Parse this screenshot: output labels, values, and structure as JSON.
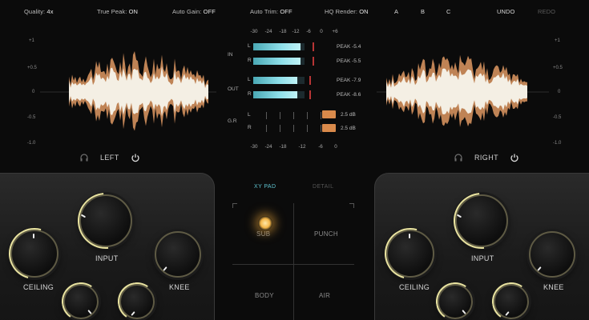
{
  "top_bar": {
    "quality_label": "Quality:",
    "quality_value": "4x",
    "true_peak_label": "True Peak:",
    "true_peak_value": "ON",
    "auto_gain_label": "Auto Gain:",
    "auto_gain_value": "OFF",
    "auto_trim_label": "Auto Trim:",
    "auto_trim_value": "OFF",
    "hq_render_label": "HQ Render:",
    "hq_render_value": "ON",
    "presets": [
      "A",
      "B",
      "C"
    ],
    "undo_label": "UNDO",
    "redo_label": "REDO"
  },
  "waveform_scale": [
    "+1",
    "+0.5",
    "0",
    "-0.5",
    "-1.0"
  ],
  "left_channel": {
    "label": "LEFT"
  },
  "right_channel": {
    "label": "RIGHT"
  },
  "meters": {
    "scale_top": [
      "-30",
      "-24",
      "-18",
      "-12",
      "-6",
      "0",
      "+6"
    ],
    "scale_bottom": [
      "-30",
      "-24",
      "-18",
      "-12",
      "-6",
      "0"
    ],
    "in_label": "IN",
    "out_label": "OUT",
    "gr_label": "G.R",
    "ch_l": "L",
    "ch_r": "R",
    "in_l": {
      "peak": "PEAK -5.4",
      "level": 0.92
    },
    "in_r": {
      "peak": "PEAK -5.5",
      "level": 0.92
    },
    "out_l": {
      "peak": "PEAK -7.9",
      "level": 0.86
    },
    "out_r": {
      "peak": "PEAK -8.6",
      "level": 0.86
    },
    "gr_l": "2.5 dB",
    "gr_r": "2.5 dB"
  },
  "xy": {
    "tab_xy": "XY PAD",
    "tab_detail": "DETAIL",
    "sub": "SUB",
    "punch": "PUNCH",
    "body": "BODY",
    "air": "AIR"
  },
  "knobs": {
    "input": "INPUT",
    "ceiling": "CEILING",
    "knee": "KNEE"
  },
  "colors": {
    "accent": "#e9e3a0",
    "meter": "#8fe0ea",
    "gr": "#d98a4b",
    "wave_core": "#f4efe4",
    "wave_edge": "#c98a5a"
  }
}
